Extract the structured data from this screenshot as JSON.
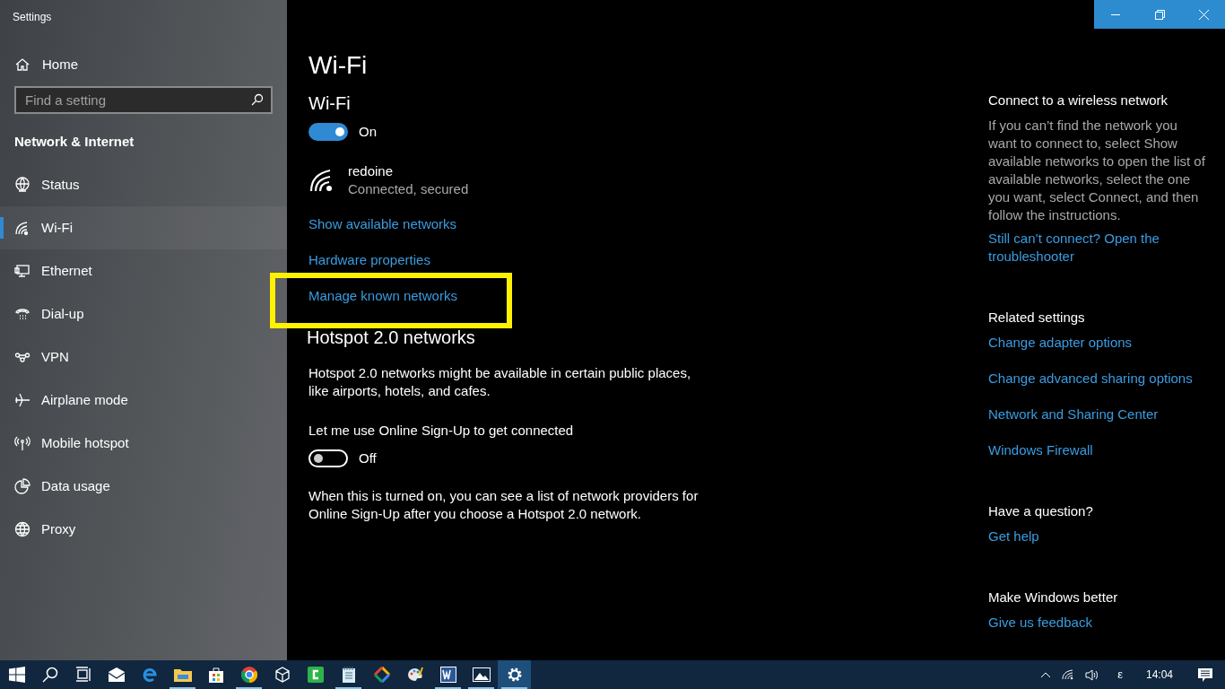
{
  "window": {
    "title": "Settings"
  },
  "sidebar": {
    "home": "Home",
    "search": {
      "placeholder": "Find a setting"
    },
    "section": "Network & Internet",
    "items": [
      {
        "label": "Status",
        "selected": false
      },
      {
        "label": "Wi-Fi",
        "selected": true
      },
      {
        "label": "Ethernet",
        "selected": false
      },
      {
        "label": "Dial-up",
        "selected": false
      },
      {
        "label": "VPN",
        "selected": false
      },
      {
        "label": "Airplane mode",
        "selected": false
      },
      {
        "label": "Mobile hotspot",
        "selected": false
      },
      {
        "label": "Data usage",
        "selected": false
      },
      {
        "label": "Proxy",
        "selected": false
      }
    ]
  },
  "main": {
    "title": "Wi-Fi",
    "wifi": {
      "heading": "Wi-Fi",
      "toggle": {
        "on": true,
        "label": "On"
      },
      "network": {
        "name": "redoine",
        "status": "Connected, secured"
      },
      "links": [
        {
          "label": "Show available networks",
          "highlighted": false
        },
        {
          "label": "Hardware properties",
          "highlighted": false
        },
        {
          "label": "Manage known networks",
          "highlighted": true
        }
      ]
    },
    "hotspot": {
      "heading": "Hotspot 2.0 networks",
      "description": "Hotspot 2.0 networks might be available in certain public places, like airports, hotels, and cafes.",
      "toggle_label": "Let me use Online Sign-Up to get connected",
      "toggle": {
        "on": false,
        "label": "Off"
      },
      "note": "When this is turned on, you can see a list of network providers for Online Sign-Up after you choose a Hotspot 2.0 network."
    }
  },
  "aside": [
    {
      "heading": "Connect to a wireless network",
      "text": "If you can’t find the network you want to connect to, select Show available networks to open the list of available networks, select the one you want, select Connect, and then follow the instructions.",
      "links": [
        "Still can’t connect? Open the troubleshooter"
      ]
    },
    {
      "heading": "Related settings",
      "links": [
        "Change adapter options",
        "Change advanced sharing options",
        "Network and Sharing Center",
        "Windows Firewall"
      ]
    },
    {
      "heading": "Have a question?",
      "links": [
        "Get help"
      ]
    },
    {
      "heading": "Make Windows better",
      "links": [
        "Give us feedback"
      ]
    }
  ],
  "taskbar": {
    "apps": [
      {
        "running": false,
        "selected": false
      },
      {
        "running": false,
        "selected": false
      },
      {
        "running": false,
        "selected": false
      },
      {
        "running": false,
        "selected": false
      },
      {
        "running": false,
        "selected": false
      },
      {
        "running": true,
        "selected": false
      },
      {
        "running": false,
        "selected": false
      },
      {
        "running": true,
        "selected": false
      },
      {
        "running": false,
        "selected": false
      },
      {
        "running": false,
        "selected": false
      },
      {
        "running": true,
        "selected": false
      },
      {
        "running": false,
        "selected": false
      },
      {
        "running": false,
        "selected": false
      },
      {
        "running": true,
        "selected": false
      },
      {
        "running": true,
        "selected": false
      },
      {
        "running": true,
        "selected": true
      }
    ],
    "language": "ε",
    "clock": "14:04"
  }
}
